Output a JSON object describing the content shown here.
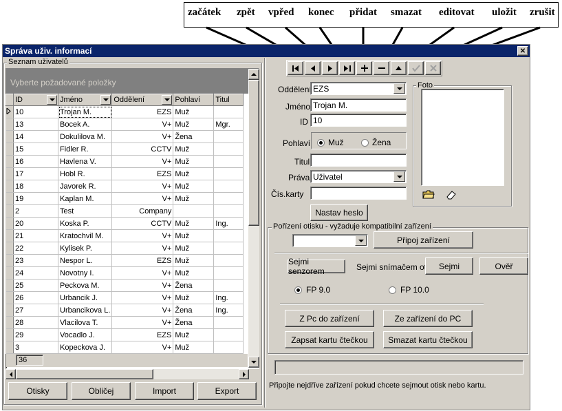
{
  "callouts": {
    "labels": [
      "začátek",
      "zpět",
      "vpřed",
      "konec",
      "přidat",
      "smazat",
      "editovat",
      "uložit",
      "zrušit"
    ]
  },
  "window": {
    "title": "Správa uživ. informací",
    "close_glyph": "✕"
  },
  "userlist": {
    "group_label": "Seznam uživatelů",
    "placeholder": "Vyberte požadované položky",
    "columns": [
      "ID",
      "Jméno",
      "Oddělení",
      "Pohlaví",
      "Titul"
    ],
    "rows": [
      [
        "10",
        "Trojan M.",
        "EZS",
        "Muž",
        ""
      ],
      [
        "13",
        "Bocek A.",
        "V+",
        "Muž",
        "Mgr."
      ],
      [
        "14",
        "Dokulilova M.",
        "V+",
        "Žena",
        ""
      ],
      [
        "15",
        "Fidler R.",
        "CCTV",
        "Muž",
        ""
      ],
      [
        "16",
        "Havlena V.",
        "V+",
        "Muž",
        ""
      ],
      [
        "17",
        "Hobl R.",
        "EZS",
        "Muž",
        ""
      ],
      [
        "18",
        "Javorek R.",
        "V+",
        "Muž",
        ""
      ],
      [
        "19",
        "Kaplan M.",
        "V+",
        "Muž",
        ""
      ],
      [
        "2",
        "Test",
        "Company",
        "",
        ""
      ],
      [
        "20",
        "Koska P.",
        "CCTV",
        "Muž",
        "Ing."
      ],
      [
        "21",
        "Kratochvil M.",
        "V+",
        "Muž",
        ""
      ],
      [
        "22",
        "Kylisek P.",
        "V+",
        "Muž",
        ""
      ],
      [
        "23",
        "Nespor L.",
        "EZS",
        "Muž",
        ""
      ],
      [
        "24",
        "Novotny I.",
        "V+",
        "Muž",
        ""
      ],
      [
        "25",
        "Peckova M.",
        "V+",
        "Žena",
        ""
      ],
      [
        "26",
        "Urbancik J.",
        "V+",
        "Muž",
        "Ing."
      ],
      [
        "27",
        "Urbancikova L.",
        "V+",
        "Žena",
        "Ing."
      ],
      [
        "28",
        "Vlacilova T.",
        "V+",
        "Žena",
        ""
      ],
      [
        "29",
        "Vocadlo J.",
        "EZS",
        "Muž",
        ""
      ],
      [
        "3",
        "Kopeckova J.",
        "V+",
        "Muž",
        ""
      ]
    ],
    "count": "36",
    "buttons": {
      "otisky": "Otisky",
      "oblicej": "Obličej",
      "import": "Import",
      "export": "Export"
    }
  },
  "form": {
    "oddeleni_label": "Oddělení",
    "oddeleni_value": "EZS",
    "jmeno_label": "Jméno",
    "jmeno_value": "Trojan M.",
    "id_label": "ID",
    "id_value": "10",
    "pohlavi_label": "Pohlaví",
    "muz": "Muž",
    "zena": "Žena",
    "titul_label": "Titul",
    "titul_value": "",
    "prava_label": "Práva",
    "prava_value": "Uživatel",
    "karta_label": "Čís.karty",
    "karta_value": "",
    "heslo_button": "Nastav heslo",
    "foto_label": "Foto"
  },
  "capture": {
    "group_label": "Pořízení otisku - vyžaduje kompatibilní zařízení",
    "device_value": "",
    "connect_button": "Připoj zařízení",
    "tab_sensor": "Sejmi senzorem",
    "tab_card": "Sejmi snímačem otisk",
    "sejmi_button": "Sejmi",
    "over_button": "Ověř",
    "fp9": "FP 9.0",
    "fp10": "FP 10.0",
    "pc_to_device": "Z Pc do zařízení",
    "device_to_pc": "Ze zařízení do PC",
    "write_card": "Zapsat kartu čtečkou",
    "erase_card": "Smazat kartu čtečkou"
  },
  "status": {
    "message": "Připojte nejdříve zařízení pokud chcete sejmout otisk nebo kartu."
  }
}
